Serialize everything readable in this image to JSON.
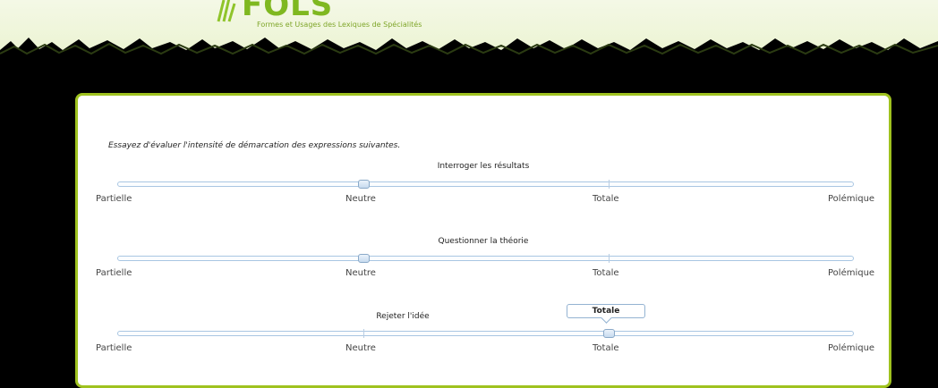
{
  "header": {
    "logo_text": "FOLS",
    "subtitle": "Formes et Usages des Lexiques de Spécialités"
  },
  "instruction": "Essayez d'évaluer l'intensité de démarcation des expressions suivantes.",
  "scale_labels": [
    "Partielle",
    "Neutre",
    "Totale",
    "Polémique"
  ],
  "questions": [
    {
      "title": "Interroger les résultats",
      "value": "Neutre",
      "position_fraction": 0.333
    },
    {
      "title": "Questionner la théorie",
      "value": "Neutre",
      "position_fraction": 0.333
    },
    {
      "title": "Rejeter l'idée",
      "value": "Totale",
      "position_fraction": 0.667,
      "tooltip": "Totale"
    }
  ],
  "colors": {
    "panel_border": "#9fc21f",
    "background": "#000000",
    "header": "#eef5d8"
  }
}
